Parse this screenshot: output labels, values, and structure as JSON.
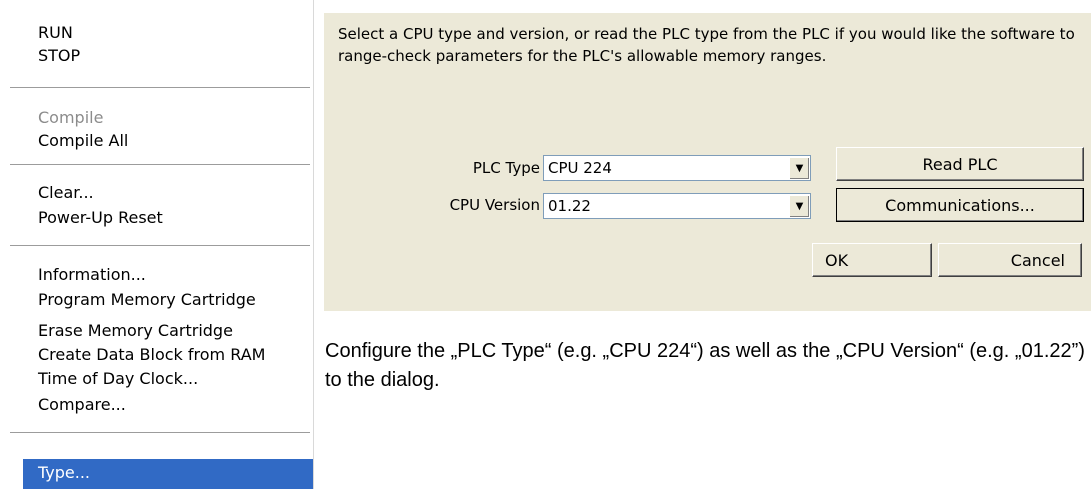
{
  "menu": {
    "items": [
      {
        "label": "RUN",
        "disabled": false
      },
      {
        "label": "STOP",
        "disabled": false
      },
      {
        "label": "Compile",
        "disabled": true
      },
      {
        "label": "Compile All",
        "disabled": false
      },
      {
        "label": "Clear...",
        "disabled": false
      },
      {
        "label": "Power-Up Reset",
        "disabled": false
      },
      {
        "label": "Information...",
        "disabled": false
      },
      {
        "label": "Program Memory Cartridge",
        "disabled": false
      },
      {
        "label": "Erase Memory Cartridge",
        "disabled": false
      },
      {
        "label": "Create Data Block from RAM",
        "disabled": false
      },
      {
        "label": "Time of Day Clock...",
        "disabled": false
      },
      {
        "label": "Compare...",
        "disabled": false
      },
      {
        "label": "Type...",
        "disabled": false,
        "selected": true
      }
    ]
  },
  "dialog": {
    "description": "Select a CPU type and version, or read the PLC type from the PLC if you would like the software to range-check parameters for the PLC's allowable memory ranges.",
    "plc_type_label": "PLC Type",
    "plc_type_value": "CPU 224",
    "cpu_version_label": "CPU Version",
    "cpu_version_value": "01.22",
    "read_plc_button": "Read PLC",
    "communications_button": "Communications...",
    "ok_button": "OK",
    "cancel_button": "Cancel"
  },
  "caption": "Configure the „PLC Type“ (e.g. „CPU 224“) as well as the „CPU Version“ (e.g. „01.22”) to the dialog.",
  "colors": {
    "menu_highlight": "#316ac5",
    "dialog_background": "#ece9d8",
    "disabled_text": "#8c8c8c"
  }
}
